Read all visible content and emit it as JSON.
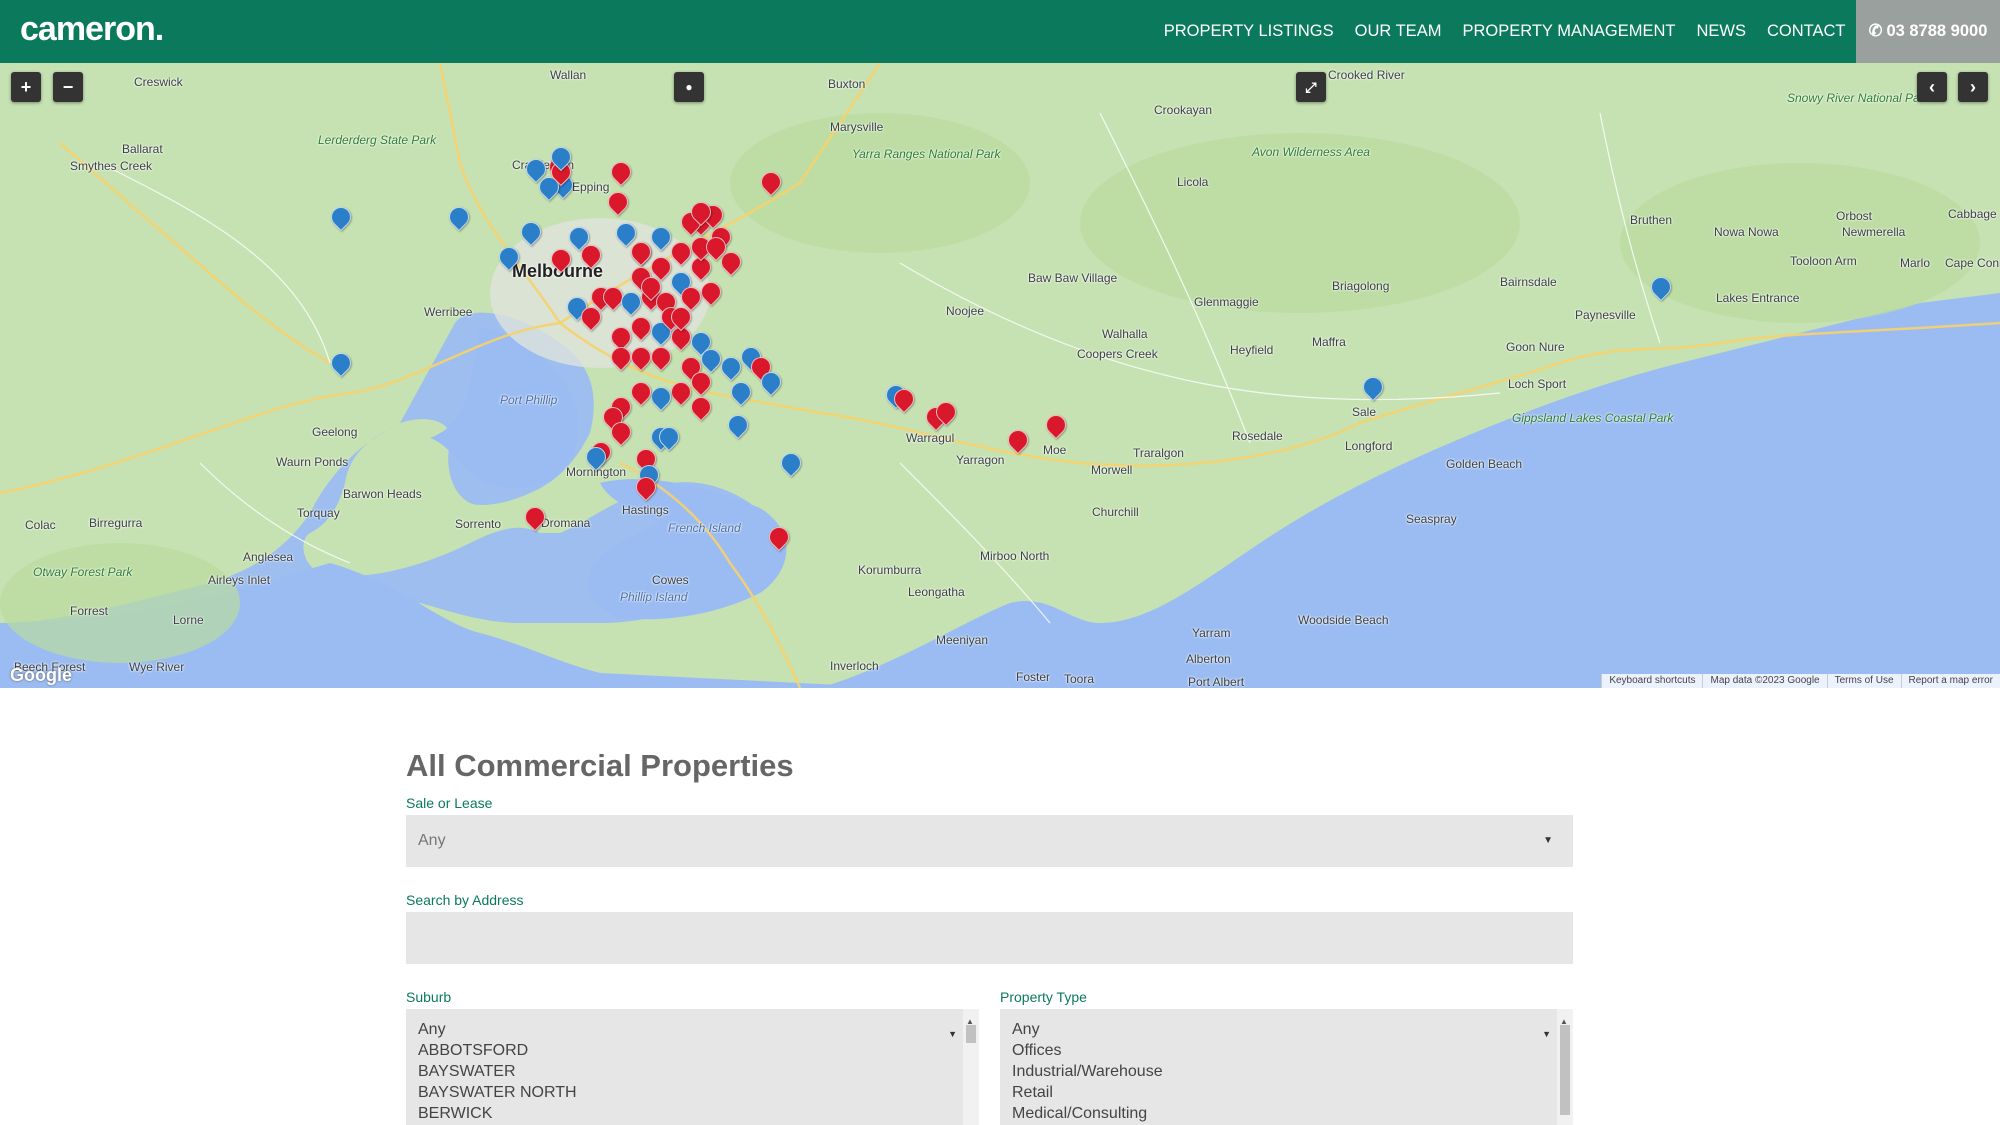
{
  "header": {
    "logo": "cameron.",
    "nav": [
      "PROPERTY LISTINGS",
      "OUR TEAM",
      "PROPERTY MANAGEMENT",
      "NEWS",
      "CONTACT"
    ],
    "phone": "03 8788 9000"
  },
  "map": {
    "controls": {
      "zoom_in": "+",
      "zoom_out": "−",
      "fullscreen": "⤢",
      "prev": "‹",
      "next": "›"
    },
    "google": "Google",
    "attribution": [
      "Keyboard shortcuts",
      "Map data ©2023 Google",
      "Terms of Use",
      "Report a map error"
    ],
    "places": [
      "Creswick",
      "Wallan",
      "Buxton",
      "Crooked River",
      "Ballarat",
      "Lerderderg State Park",
      "Marysville",
      "Yarra Ranges National Park",
      "Snowy River National Park",
      "Smythes Creek",
      "Craigieburn",
      "Epping",
      "Crookayan",
      "Licola",
      "Avon Wilderness Area",
      "Orbost",
      "Cabbage Tree Creek",
      "Melbourne",
      "Werribee",
      "Baw Baw Village",
      "Glenmaggie",
      "Briagolong",
      "Bairnsdale",
      "Bruthen",
      "Nowa Nowa",
      "Newmerella",
      "Marlo",
      "Cape Conran",
      "Tooloon Arm",
      "Lakes Entrance",
      "Paynesville",
      "Noojee",
      "Walhalla",
      "Coopers Creek",
      "Heyfield",
      "Maffra",
      "Goon Nure",
      "Loch Sport",
      "Sale",
      "Longford",
      "Rosedale",
      "Geelong",
      "Waurn Ponds",
      "Barwon Heads",
      "Torquay",
      "Colac",
      "Birregurra",
      "Anglesea",
      "Otway Forest Park",
      "Airleys Inlet",
      "Forrest",
      "Lorne",
      "Beech Forest",
      "Wye River",
      "Sorrento",
      "Dromana",
      "Mornington",
      "Hastings",
      "French Island",
      "Cowes",
      "Phillip Island",
      "Warragul",
      "Yarragon",
      "Moe",
      "Morwell",
      "Traralgon",
      "Churchill",
      "Mirboo North",
      "Leongatha",
      "Korumburra",
      "Meeniyan",
      "Inverloch",
      "Foster",
      "Toora",
      "Alberton",
      "Yarram",
      "Woodside Beach",
      "Port Albert",
      "Gippsland Lakes Coastal Park",
      "Golden Beach",
      "Seaspray",
      "Port Phillip"
    ],
    "pin_colors": {
      "red": "#d9182b",
      "blue": "#2a7fc8"
    }
  },
  "main": {
    "title": "All Commercial Properties",
    "sale_or_lease": {
      "label": "Sale or Lease",
      "value": "Any"
    },
    "address": {
      "label": "Search by Address",
      "value": ""
    },
    "suburb": {
      "label": "Suburb",
      "options": [
        "Any",
        "ABBOTSFORD",
        "BAYSWATER",
        "BAYSWATER NORTH",
        "BERWICK"
      ]
    },
    "property_type": {
      "label": "Property Type",
      "options": [
        "Any",
        "Offices",
        "Industrial/Warehouse",
        "Retail",
        "Medical/Consulting"
      ]
    }
  }
}
